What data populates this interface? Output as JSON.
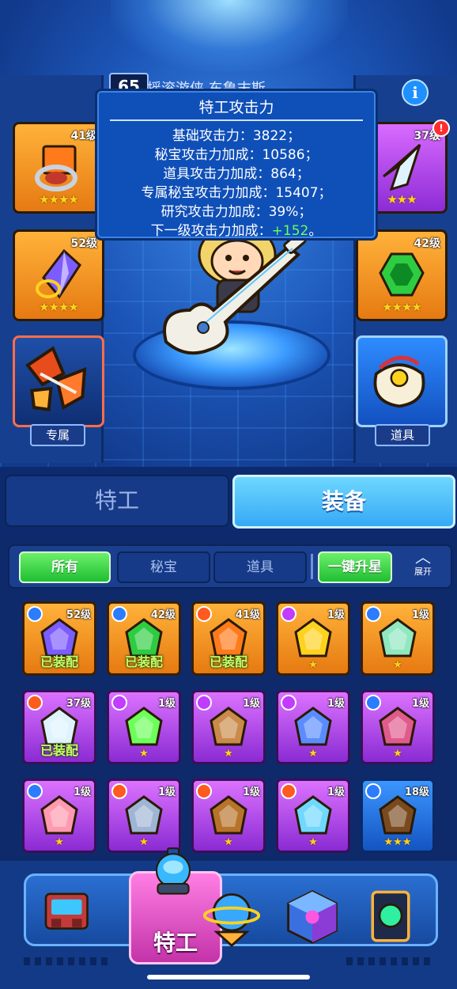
{
  "hero": {
    "level": "65",
    "name": "摇滚游侠 东鲁末斯"
  },
  "info_button": "i",
  "equipped": {
    "left": [
      {
        "level": "41级",
        "stars": "★★★★",
        "rarity": "orange"
      },
      {
        "level": "52级",
        "stars": "★★★★",
        "rarity": "orange"
      },
      {
        "level": "",
        "stars": "",
        "rarity": "dark"
      }
    ],
    "right": [
      {
        "level": "37级",
        "stars": "★★★",
        "rarity": "purple"
      },
      {
        "level": "42级",
        "stars": "★★★★",
        "rarity": "orange"
      },
      {
        "level": "",
        "stars": "",
        "rarity": "blue"
      }
    ],
    "exclusive_label": "专属",
    "item_label": "道具"
  },
  "tooltip": {
    "title": "特工攻击力",
    "rows": [
      {
        "label": "基础攻击力：",
        "value": "3822；"
      },
      {
        "label": "秘宝攻击力加成：",
        "value": "10586；"
      },
      {
        "label": "道具攻击力加成：",
        "value": "864；"
      },
      {
        "label": "专属秘宝攻击力加成：",
        "value": "15407；"
      },
      {
        "label": "研究攻击力加成：",
        "value": "39%；"
      },
      {
        "label": "下一级攻击力加成：",
        "value": "+152",
        "suffix": "。"
      }
    ]
  },
  "tabs": {
    "agent": "特工",
    "equipment": "装备"
  },
  "filters": {
    "all": "所有",
    "treasure": "秘宝",
    "item": "道具",
    "upgrade_all": "一键升星",
    "expand": "展开"
  },
  "inventory": [
    {
      "level": "52级",
      "rarity": "orange",
      "q": "blue",
      "stars": "★★★★",
      "equipped": "已装配"
    },
    {
      "level": "42级",
      "rarity": "orange",
      "q": "blue",
      "stars": "★★★★",
      "equipped": "已装配"
    },
    {
      "level": "41级",
      "rarity": "orange",
      "q": "red",
      "stars": "★★★★",
      "equipped": "已装配"
    },
    {
      "level": "1级",
      "rarity": "orange",
      "q": "pink",
      "stars": "★",
      "equipped": ""
    },
    {
      "level": "1级",
      "rarity": "orange",
      "q": "blue",
      "stars": "★",
      "equipped": ""
    },
    {
      "level": "37级",
      "rarity": "purple",
      "q": "red",
      "stars": "★★★",
      "equipped": "已装配"
    },
    {
      "level": "1级",
      "rarity": "purple",
      "q": "pink",
      "stars": "★",
      "equipped": ""
    },
    {
      "level": "1级",
      "rarity": "purple",
      "q": "pink",
      "stars": "★",
      "equipped": ""
    },
    {
      "level": "1级",
      "rarity": "purple",
      "q": "pink",
      "stars": "★",
      "equipped": ""
    },
    {
      "level": "1级",
      "rarity": "purple",
      "q": "blue",
      "stars": "★",
      "equipped": ""
    },
    {
      "level": "1级",
      "rarity": "purple",
      "q": "blue",
      "stars": "★",
      "equipped": ""
    },
    {
      "level": "1级",
      "rarity": "purple",
      "q": "red",
      "stars": "★",
      "equipped": ""
    },
    {
      "level": "1级",
      "rarity": "purple",
      "q": "red",
      "stars": "★",
      "equipped": ""
    },
    {
      "level": "1级",
      "rarity": "purple",
      "q": "red",
      "stars": "★",
      "equipped": ""
    },
    {
      "level": "18级",
      "rarity": "blue",
      "q": "blue",
      "stars": "★★★",
      "equipped": ""
    }
  ],
  "nav": {
    "active_label": "特工"
  },
  "colors": {
    "orange": "#e67a12",
    "purple": "#8a2bd3",
    "blue": "#1454c2",
    "active_green": "#1fbe32",
    "tooltip_green": "#6dff5a",
    "star": "#ffd21f"
  }
}
